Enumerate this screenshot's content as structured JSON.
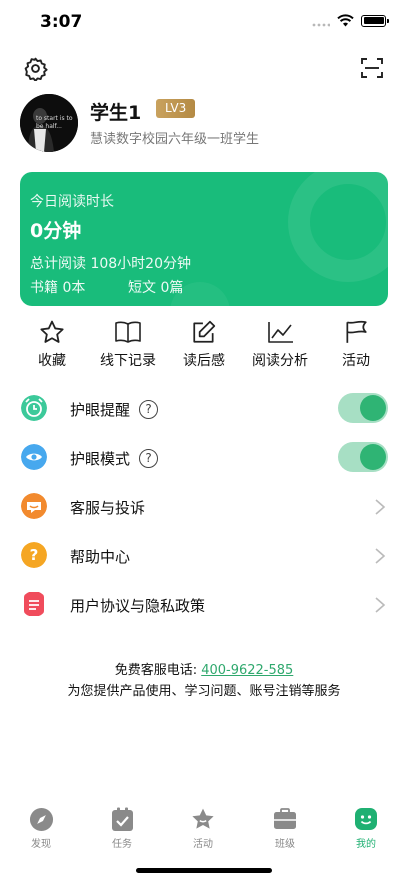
{
  "status_bar": {
    "time": "3:07"
  },
  "toolbar": {
    "settings_icon": "gear-icon",
    "scan_icon": "scan-icon"
  },
  "profile": {
    "name": "学生1",
    "level": "LV3",
    "school": "慧读数字校园六年级一班学生",
    "avatar_text": "to start is to be half..."
  },
  "reading_card": {
    "title": "今日阅读时长",
    "today": "0分钟",
    "total": "总计阅读 108小时20分钟",
    "books": "书籍 0本",
    "articles": "短文 0篇",
    "color": "#19bc7b"
  },
  "quick_actions": [
    {
      "label": "收藏",
      "icon": "star-icon"
    },
    {
      "label": "线下记录",
      "icon": "book-icon"
    },
    {
      "label": "读后感",
      "icon": "edit-icon"
    },
    {
      "label": "阅读分析",
      "icon": "line-chart-icon"
    },
    {
      "label": "活动",
      "icon": "flag-icon"
    }
  ],
  "settings": {
    "eye_reminder": {
      "label": "护眼提醒",
      "enabled": true,
      "help": "?"
    },
    "eye_mode": {
      "label": "护眼模式",
      "enabled": true,
      "help": "?"
    },
    "service": {
      "label": "客服与投诉"
    },
    "help_center": {
      "label": "帮助中心",
      "mark": "?"
    },
    "agreement": {
      "label": "用户协议与隐私政策"
    }
  },
  "contact": {
    "phone_label": "免费客服电话: ",
    "phone": "400-9622-585",
    "description": "为您提供产品使用、学习问题、账号注销等服务"
  },
  "tabs": [
    {
      "label": "发现",
      "icon": "compass-icon",
      "active": false
    },
    {
      "label": "任务",
      "icon": "task-icon",
      "active": false
    },
    {
      "label": "活动",
      "icon": "star-badge-icon",
      "active": false
    },
    {
      "label": "班级",
      "icon": "class-icon",
      "active": false
    },
    {
      "label": "我的",
      "icon": "smile-icon",
      "active": true
    }
  ],
  "colors": {
    "accent": "#1fb072",
    "toggle_track": "#a7dfc4",
    "toggle_knob": "#2fb474"
  }
}
